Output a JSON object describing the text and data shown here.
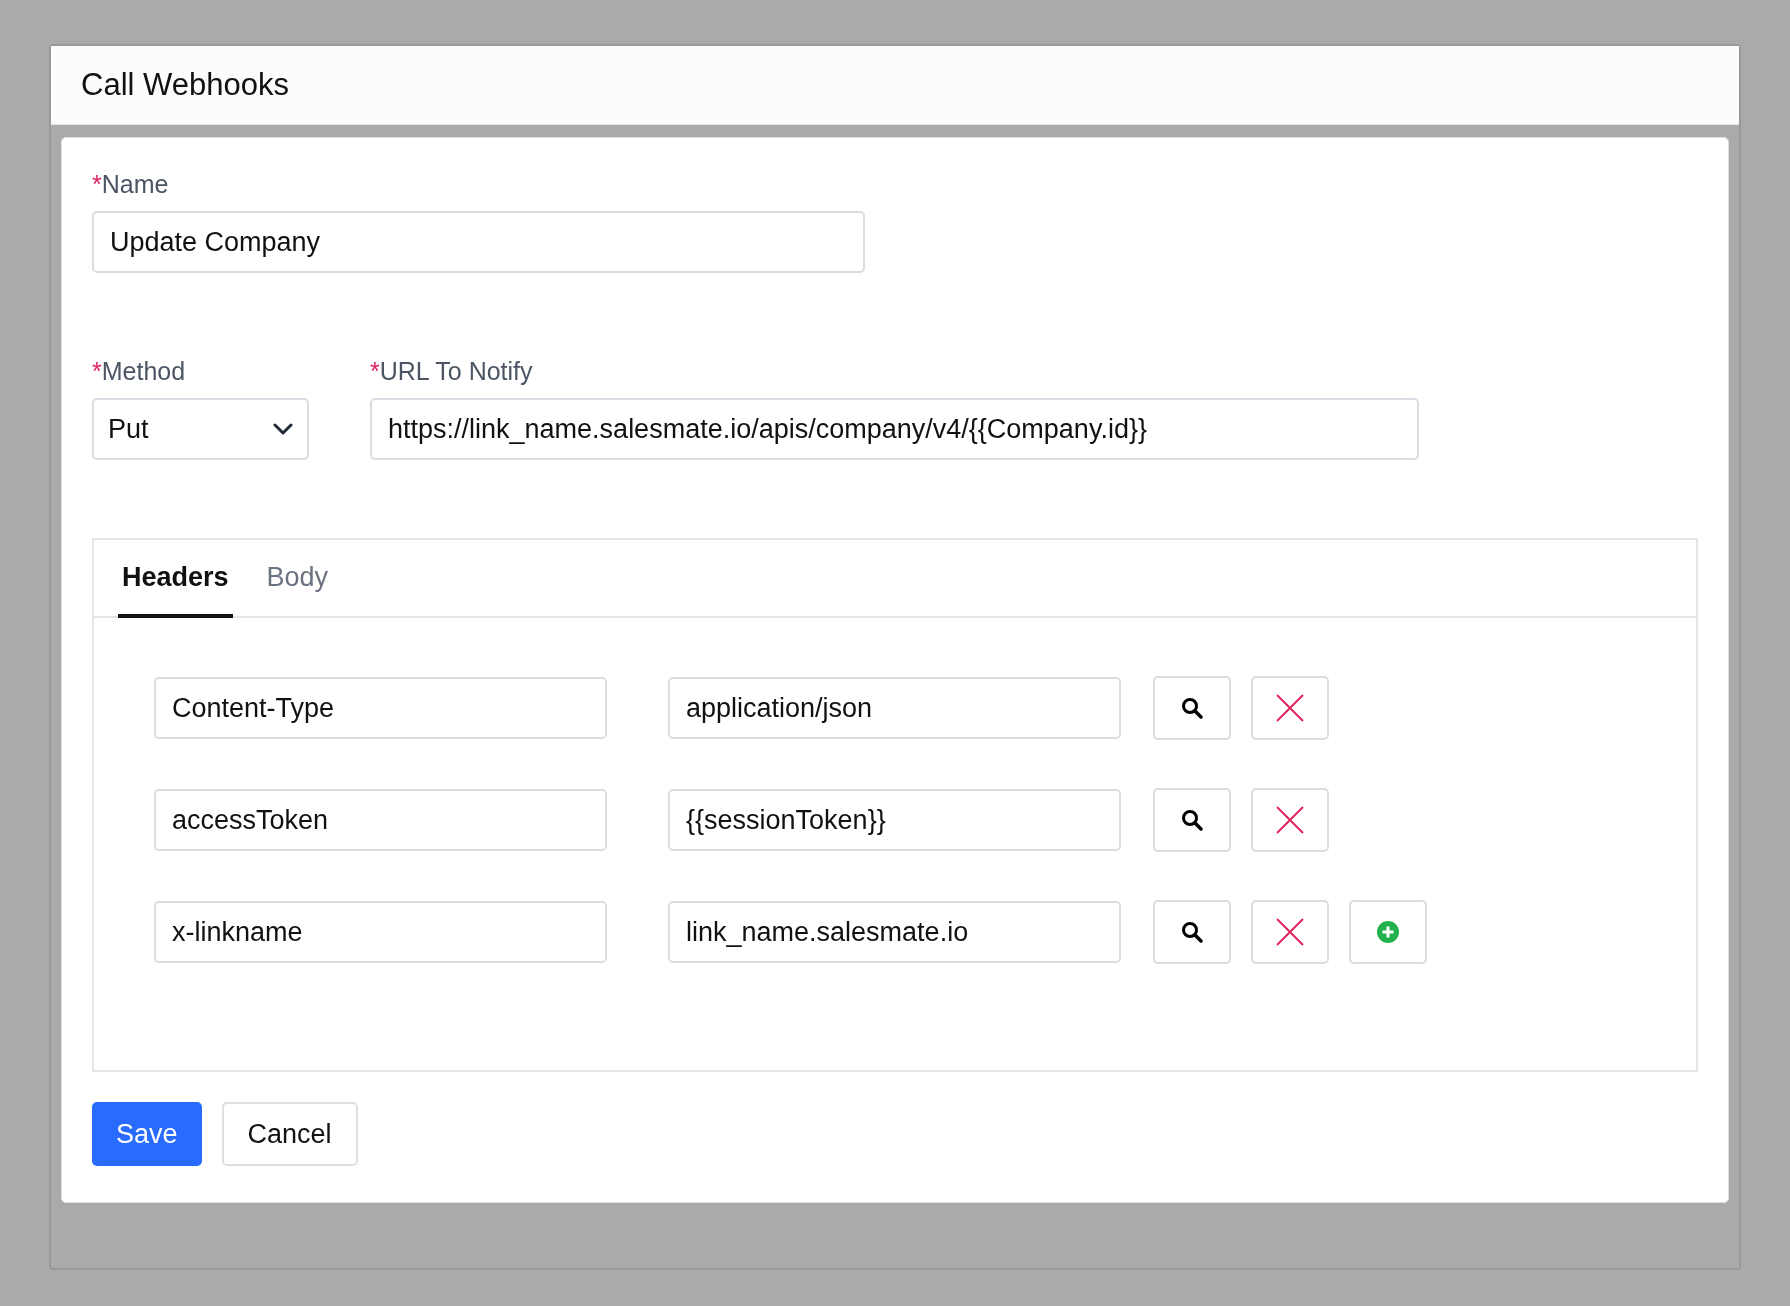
{
  "dialog": {
    "title": "Call Webhooks"
  },
  "name_field": {
    "required_mark": "*",
    "label": "Name",
    "value": "Update Company"
  },
  "method_field": {
    "required_mark": "*",
    "label": "Method",
    "value": "Put"
  },
  "url_field": {
    "required_mark": "*",
    "label": "URL To Notify",
    "value": "https://link_name.salesmate.io/apis/company/v4/{{Company.id}}"
  },
  "tabs": [
    {
      "label": "Headers",
      "selected": true
    },
    {
      "label": "Body",
      "selected": false
    }
  ],
  "headers": [
    {
      "key": "Content-Type",
      "value": "application/json",
      "can_add": false
    },
    {
      "key": "accessToken",
      "value": "{{sessionToken}}",
      "can_add": false
    },
    {
      "key": "x-linkname",
      "value": "link_name.salesmate.io",
      "can_add": true
    }
  ],
  "buttons": [
    {
      "label": "Save",
      "kind": "primary"
    },
    {
      "label": "Cancel",
      "kind": "secondary"
    }
  ]
}
